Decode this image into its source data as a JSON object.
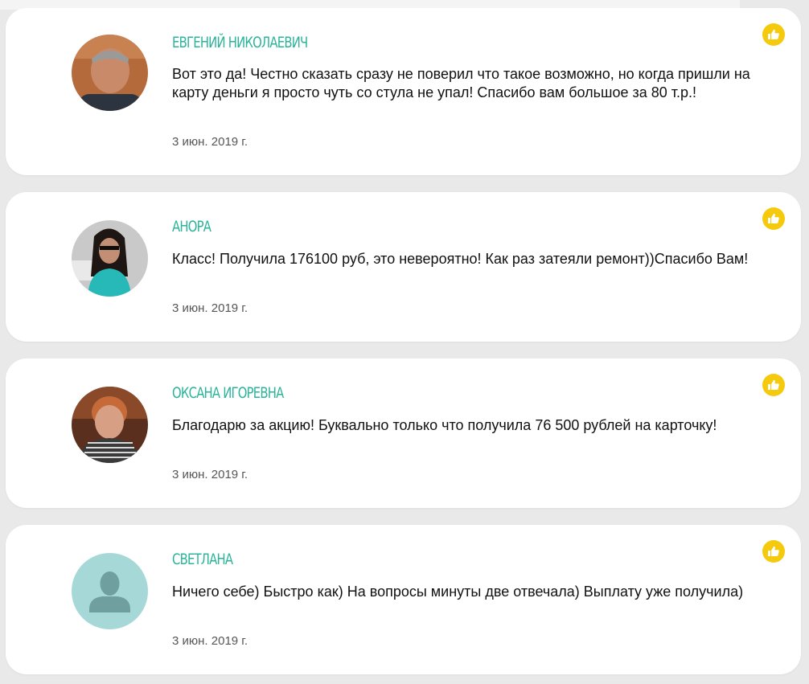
{
  "reviews": [
    {
      "name": "ЕВГЕНИЙ НИКОЛАЕВИЧ",
      "text": "Вот это да! Честно сказать сразу не поверил что такое возможно, но когда пришли на карту деньги я просто чуть со стула не упал! Спасибо вам большое за 80 т.р.!",
      "date": "3 июн. 2019 г."
    },
    {
      "name": "АНОРА",
      "text": "Класс! Получила 176100 руб, это невероятно! Как раз затеяли ремонт))Спасибо Вам!",
      "date": "3 июн. 2019 г."
    },
    {
      "name": "ОКСАНА ИГОРЕВНА",
      "text": "Благодарю за акцию! Буквально только что получила 76 500 рублей на карточку!",
      "date": "3 июн. 2019 г."
    },
    {
      "name": "СВЕТЛАНА",
      "text": "Ничего себе) Быстро как) На вопросы минуты две отвечала) Выплату уже получила)",
      "date": "3 июн. 2019 г."
    }
  ],
  "icons": {
    "like": "thumbs-up-icon",
    "default_avatar": "user-silhouette-icon"
  },
  "colors": {
    "name": "#2bb49a",
    "like_badge": "#f5c90c",
    "default_avatar_bg": "#a6d8d8",
    "default_avatar_fg": "#6f9f9f"
  }
}
